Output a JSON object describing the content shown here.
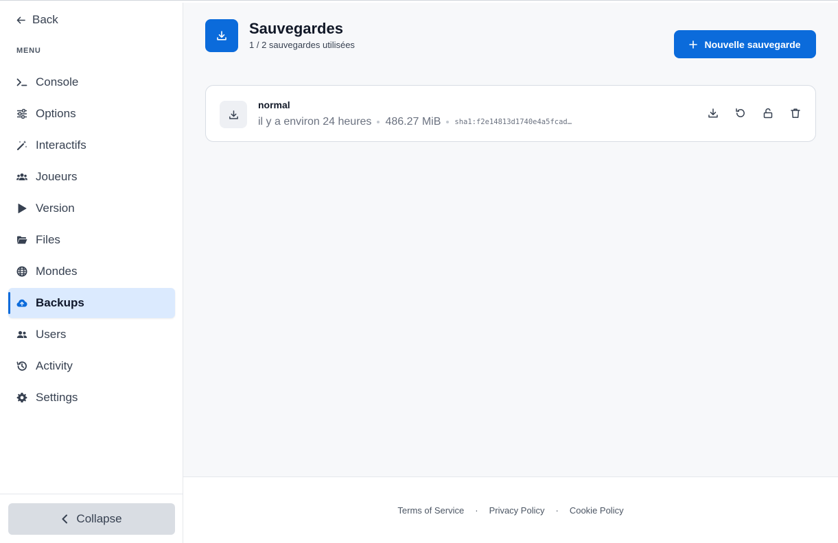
{
  "sidebar": {
    "back_label": "Back",
    "menu_label": "MENU",
    "items": [
      {
        "label": "Console",
        "icon": "terminal-icon"
      },
      {
        "label": "Options",
        "icon": "sliders-icon"
      },
      {
        "label": "Interactifs",
        "icon": "magic-wand-icon"
      },
      {
        "label": "Joueurs",
        "icon": "players-icon"
      },
      {
        "label": "Version",
        "icon": "play-icon"
      },
      {
        "label": "Files",
        "icon": "folder-icon"
      },
      {
        "label": "Mondes",
        "icon": "globe-icon"
      },
      {
        "label": "Backups",
        "icon": "cloud-upload-icon",
        "active": true
      },
      {
        "label": "Users",
        "icon": "users-icon"
      },
      {
        "label": "Activity",
        "icon": "history-icon"
      },
      {
        "label": "Settings",
        "icon": "gear-icon"
      }
    ],
    "collapse_label": "Collapse"
  },
  "header": {
    "title": "Sauvegardes",
    "subtitle": "1 / 2 sauvegardes utilisées",
    "new_button_label": "Nouvelle sauvegarde"
  },
  "backups": [
    {
      "name": "normal",
      "date": "il y a environ 24 heures",
      "size": "486.27 MiB",
      "hash": "sha1:f2e14813d1740e4a5fcad…"
    }
  ],
  "footer": {
    "terms": "Terms of Service",
    "privacy": "Privacy Policy",
    "cookie": "Cookie Policy",
    "separator": "·"
  },
  "colors": {
    "accent": "#0b6bdb",
    "active_bg": "#dbeafe",
    "main_bg": "#f7f8fa"
  }
}
